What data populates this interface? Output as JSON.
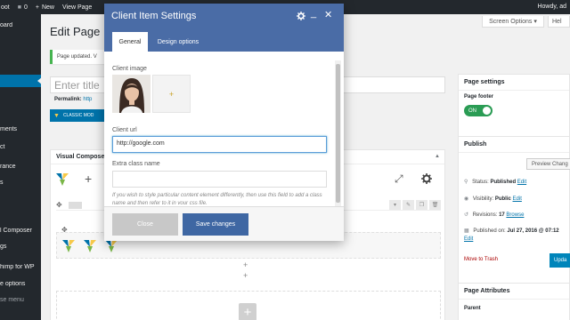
{
  "admin_bar": {
    "site_label": "oot",
    "comments_count": "0",
    "new_label": "New",
    "view_page_label": "View Page",
    "greeting": "Howdy, ad"
  },
  "admin_menu": {
    "items": [
      "oard",
      "ments",
      "ct",
      "rance",
      "s",
      "l Composer",
      "gs",
      "himp for WP",
      "e options",
      "se menu"
    ]
  },
  "header": {
    "screen_options": "Screen Options ▾",
    "help": "Hel",
    "page_title": "Edit Page"
  },
  "notice": {
    "text": "Page updated. V"
  },
  "editor": {
    "title_placeholder": "Enter title",
    "permalink_label": "Permalink:",
    "permalink_url": "http",
    "classic_mode_label": "CLASSIC MOD",
    "visual_composer_label": "Visual Compose"
  },
  "sidebar": {
    "page_settings_title": "Page settings",
    "page_footer_label": "Page footer",
    "page_footer_toggle": "ON",
    "publish_title": "Publish",
    "preview_label": "Preview Chang",
    "status_label": "Status:",
    "status_value": "Published",
    "visibility_label": "Visibility:",
    "visibility_value": "Public",
    "revisions_label": "Revisions:",
    "revisions_value": "17",
    "browse_label": "Browse",
    "published_on_label": "Published on:",
    "published_on_value": "Jul 27, 2016 @ 07:12",
    "edit_label": "Edit",
    "move_to_trash": "Move to Trash",
    "update_label": "Upda",
    "page_attributes_title": "Page Attributes",
    "parent_label": "Parent"
  },
  "modal": {
    "title": "Client Item Settings",
    "tabs": [
      {
        "label": "General",
        "active": true
      },
      {
        "label": "Design options",
        "active": false
      }
    ],
    "client_image_label": "Client image",
    "add_image_symbol": "+",
    "client_url_label": "Client url",
    "client_url_value": "http://google.com",
    "extra_class_label": "Extra class name",
    "extra_class_value": "",
    "help_text": "If you wish to style particular content element differently, then use this field to add a class name and then refer to it in your css file.",
    "close_label": "Close",
    "save_label": "Save changes"
  },
  "colors": {
    "modal_header": "#4a6ca6",
    "save_button": "#3f67a3",
    "admin_bar": "#23282d",
    "wp_blue": "#0073aa",
    "toggle_green": "#2a9c54"
  },
  "icons": [
    "gear-icon",
    "minimize-icon",
    "close-icon",
    "plus-icon",
    "fullscreen-icon",
    "move-icon",
    "pencil-icon",
    "copy-icon",
    "trash-icon",
    "pin-icon",
    "eye-icon",
    "revisions-icon",
    "calendar-icon"
  ]
}
